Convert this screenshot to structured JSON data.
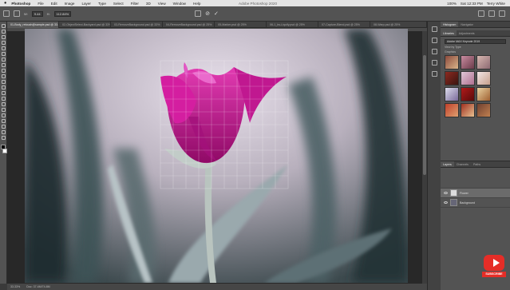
{
  "menubar": {
    "app": "Photoshop",
    "items": [
      "File",
      "Edit",
      "Image",
      "Layer",
      "Type",
      "Select",
      "Filter",
      "3D",
      "View",
      "Window",
      "Help"
    ],
    "title": "Adobe Photoshop 2020",
    "status_right": [
      "100%",
      "Sat 12:33 PM",
      "Terry White"
    ]
  },
  "options_bar": {
    "field1_label": "W:",
    "field1_value": "9.44",
    "field2_label": "H:",
    "field2_value": "112.84%",
    "commit_glyph": "✓",
    "cancel_glyph": "⊘"
  },
  "doc_tabs": [
    {
      "label": "01-Body_retouch@sample.psd @ 33.3% (Base, RGB/8)",
      "active": true
    },
    {
      "label": "02-ObjectSelect-Backyard.psd @ 33%",
      "active": false
    },
    {
      "label": "03-RemoveBackground.psd @ 33%",
      "active": false
    },
    {
      "label": "04-RemoveBackground.psd @ 25%",
      "active": false
    },
    {
      "label": "05-Marker.psd @ 25%",
      "active": false
    },
    {
      "label": "06-1_bs-Liquify.psd @ 25%",
      "active": false
    },
    {
      "label": "07-Capture-Blend.psd @ 25%",
      "active": false
    },
    {
      "label": "08-Warp.psd @ 25%",
      "active": false
    }
  ],
  "status_bar": {
    "zoom": "33.33%",
    "doc_info": "Doc: 37.4M/74.8M"
  },
  "panels": {
    "top_tabs": [
      "Histogram",
      "Navigator"
    ],
    "second_tabs": [
      "Libraries",
      "Adjustments"
    ],
    "library_select": "Adobe MAX Keynote 2019",
    "view_by": "View by Type",
    "graphics_label": "Graphics",
    "layers_tabs": [
      "Layers",
      "Channels",
      "Paths"
    ],
    "layers": [
      {
        "name": "Flower",
        "selected": true
      },
      {
        "name": "Background",
        "selected": false
      }
    ]
  },
  "youtube": {
    "subscribe": "SUBSCRIBE"
  }
}
